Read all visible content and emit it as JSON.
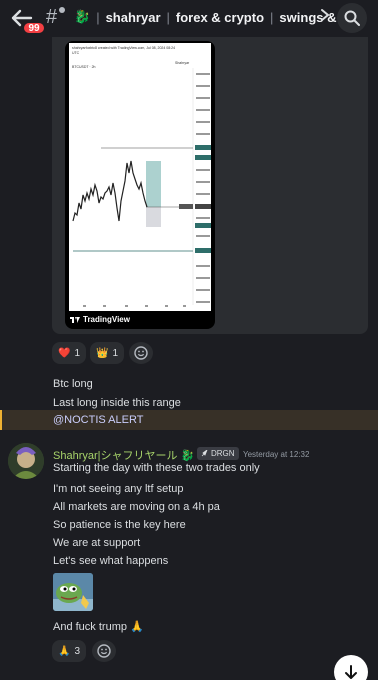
{
  "header": {
    "unread_count": "99",
    "server_emoji": "🐉",
    "title_parts": [
      "shahryar",
      "forex & crypto",
      "swings & ..."
    ]
  },
  "embed": {
    "chart_header": "shahryarfoxbtc8 created with TradingView.com, Jul 08, 2024 08:24 UTC",
    "ticker": "BTCUSDT · 2h",
    "author": "Shahryar",
    "brand": "TradingView"
  },
  "reactions_1": [
    {
      "emoji": "❤️",
      "count": "1",
      "icon": "heart-icon"
    },
    {
      "emoji": "👑",
      "count": "1",
      "icon": "crown-icon"
    }
  ],
  "messages_1": [
    "Btc long",
    "Last long inside this range"
  ],
  "mention": "@NOCTIS ALERT",
  "author": {
    "name": "Shahryar|シャフリヤール 🐉",
    "role_tag": "DRGN",
    "timestamp": "Yesterday at 12:32"
  },
  "messages_2": [
    "Starting the day with these two trades only",
    "I'm not seeing any ltf setup",
    "All markets are moving on a 4h pa",
    "So patience is the key here",
    "We are at support",
    "Let's see what happens"
  ],
  "message_last": "And fuck trump 🙏",
  "reactions_2": [
    {
      "emoji": "🙏",
      "count": "3",
      "icon": "pray-icon"
    }
  ],
  "colors": {
    "background": "#1c1d22",
    "card": "#2b2d31",
    "username": "#a7d36a",
    "mention_bar": "#f0b232",
    "badge": "#f23f43"
  }
}
